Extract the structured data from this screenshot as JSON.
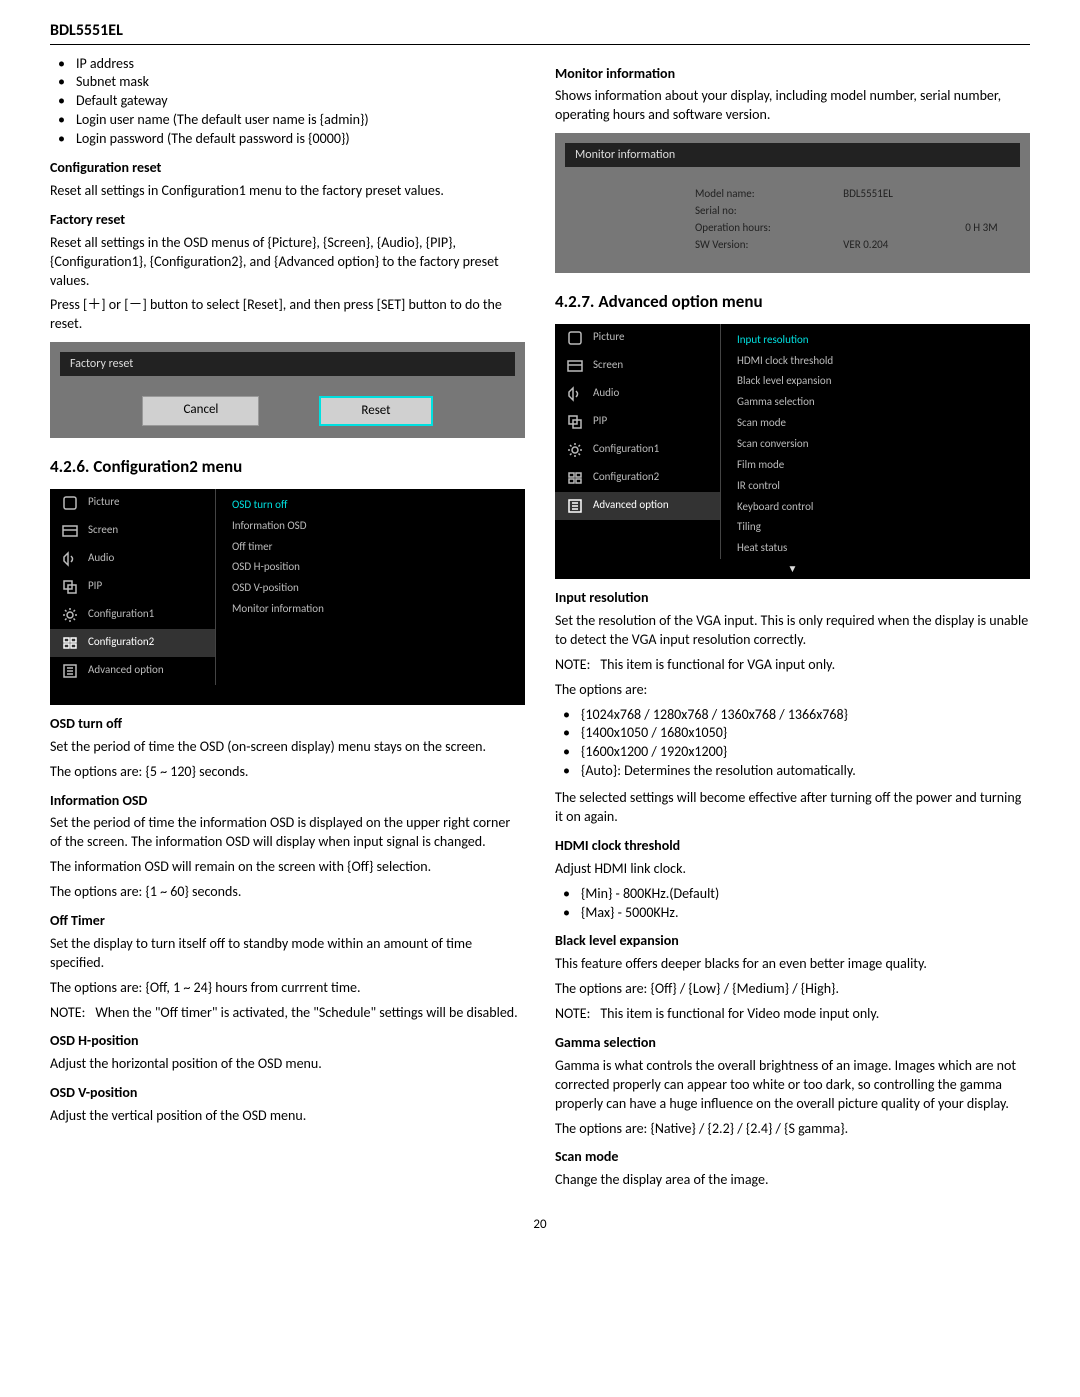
{
  "header": "BDL5551EL",
  "pageNumber": "20",
  "left": {
    "bullets1": [
      "IP address",
      "Subnet mask",
      "Default gateway",
      "Login user name (The default user name is {admin})",
      "Login password (The default password is {0000})"
    ],
    "configReset": {
      "title": "Configuration reset",
      "text": "Reset all settings in Configuration1 menu to the factory preset values."
    },
    "factoryReset": {
      "title": "Factory reset",
      "p1": "Reset all settings in the OSD menus of {Picture}, {Screen}, {Audio}, {PIP}, {Configuration1}, {Configuration2}, and {Advanced option} to the factory preset values.",
      "p2": "Press [＋] or [－] button to select [Reset], and then press [SET] button to do the reset.",
      "osdTitle": "Factory reset",
      "cancel": "Cancel",
      "reset": "Reset"
    },
    "section": "4.2.6.  Configuration2 menu",
    "menu": {
      "items": [
        "Picture",
        "Screen",
        "Audio",
        "PIP",
        "Configuration1",
        "Configuration2",
        "Advanced option"
      ],
      "selectedIndex": 5,
      "right": [
        "OSD turn off",
        "Information OSD",
        "Off timer",
        "OSD H-position",
        "OSD V-position",
        "Monitor information"
      ]
    },
    "osdTurnOff": {
      "title": "OSD turn off",
      "p1": "Set the period of time the OSD (on-screen display) menu stays on the screen.",
      "p2": "The options are: {5 ~ 120} seconds."
    },
    "infoOSD": {
      "title": "Information OSD",
      "p1": "Set the period of time the information OSD is displayed on the upper right corner of the screen. The information OSD will display when input signal is changed.",
      "p2": "The information OSD will remain on the screen with {Off} selection.",
      "p3": "The options are: {1 ~ 60} seconds."
    },
    "offTimer": {
      "title": "Off Timer",
      "p1": "Set the display to turn itself off to standby mode within an amount of time specified.",
      "p2": "The options are: {Off, 1 ~ 24} hours from currrent time.",
      "noteLabel": "NOTE:",
      "noteText": "When the \"Off timer\" is activated, the \"Schedule\" settings will be disabled."
    },
    "osdH": {
      "title": "OSD H-position",
      "p1": "Adjust the horizontal position of the OSD menu."
    },
    "osdV": {
      "title": "OSD V-position",
      "p1": "Adjust the vertical position of the OSD menu."
    }
  },
  "right": {
    "monInfo": {
      "title": "Monitor information",
      "p1": "Shows information about your display, including model number, serial number, operating hours and software version.",
      "osdTitle": "Monitor information",
      "rows": {
        "modelLabel": "Model name:",
        "modelVal": "BDL5551EL",
        "serialLabel": "Serial no:",
        "serialVal": "",
        "opLabel": "Operation hours:",
        "opVal": "0 H   3M",
        "swLabel": "SW Version:",
        "swVal": "VER 0.204"
      }
    },
    "section": "4.2.7.  Advanced option menu",
    "menu": {
      "items": [
        "Picture",
        "Screen",
        "Audio",
        "PIP",
        "Configuration1",
        "Configuration2",
        "Advanced option"
      ],
      "selectedIndex": 6,
      "right": [
        "Input resolution",
        "HDMI clock threshold",
        "Black level expansion",
        "Gamma selection",
        "Scan mode",
        "Scan conversion",
        "Film mode",
        "IR control",
        "Keyboard control",
        "Tiling",
        "Heat status"
      ]
    },
    "inputRes": {
      "title": "Input resolution",
      "p1": "Set the resolution of the VGA input. This is only required when the display is unable to detect the VGA input resolution correctly.",
      "noteLabel": "NOTE:",
      "noteText": "This item is functional for VGA input only.",
      "p2": "The options are:",
      "opts": [
        "{1024x768 / 1280x768 / 1360x768 / 1366x768}",
        "{1400x1050 / 1680x1050}",
        "{1600x1200 / 1920x1200}",
        "{Auto}: Determines the resolution automatically."
      ],
      "p3": "The selected settings will become effective after turning off the power and turning it on again."
    },
    "hdmi": {
      "title": "HDMI clock threshold",
      "p1": "Adjust HDMI link clock.",
      "opts": [
        "{Min} - 800KHz.(Default)",
        "{Max} - 5000KHz."
      ]
    },
    "black": {
      "title": "Black level expansion",
      "p1": "This feature offers deeper blacks for an even better image quality.",
      "p2": "The options are: {Off} / {Low} / {Medium} / {High}.",
      "noteLabel": "NOTE:",
      "noteText": "This item is functional for Video mode input only."
    },
    "gamma": {
      "title": "Gamma selection",
      "p1": "Gamma is what controls the overall brightness of an image. Images which are not corrected  properly can appear too white or too dark, so controlling the gamma properly can have a huge influence on the overall picture quality of your display.",
      "p2": "The options are: {Native} / {2.2} / {2.4} / {S gamma}."
    },
    "scan": {
      "title": "Scan mode",
      "p1": "Change the display area of the image."
    }
  }
}
